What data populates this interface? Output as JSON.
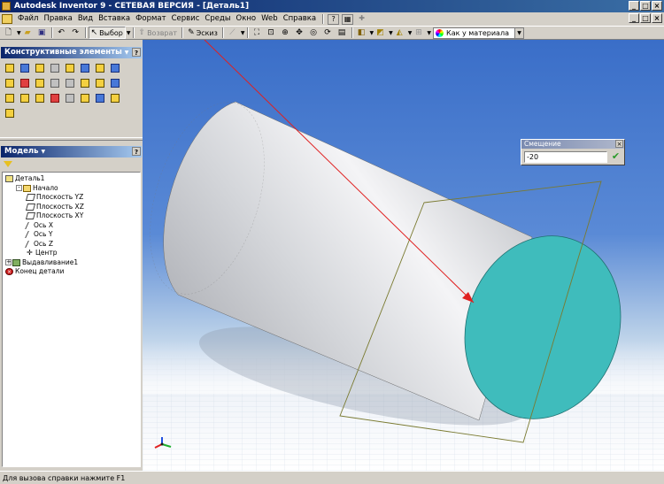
{
  "window": {
    "title": "Autodesk Inventor 9 - СЕТЕВАЯ ВЕРСИЯ - [Деталь1]",
    "controls": [
      "_",
      "□",
      "×"
    ]
  },
  "menu": {
    "items": [
      "Файл",
      "Правка",
      "Вид",
      "Вставка",
      "Формат",
      "Сервис",
      "Среды",
      "Окно",
      "Web",
      "Справка"
    ],
    "help_button": "?"
  },
  "toolbar": {
    "select_label": "Выбор",
    "return_label": "Возврат",
    "sketch_label": "Эскиз",
    "material_value": "Как у материала"
  },
  "features_panel": {
    "title": "Конструктивные элементы",
    "icons": [
      "extrude-icon",
      "revolve-icon",
      "hole-icon",
      "shell-icon",
      "rib-icon",
      "loft-icon",
      "sweep-icon",
      "coil-icon",
      "thread-icon",
      "fillet-icon",
      "chamfer-icon",
      "face-draft-icon",
      "split-icon",
      "move-face-icon",
      "mirror-icon",
      "pattern-icon",
      "work-plane-icon",
      "work-axis-icon",
      "work-point-icon",
      "ucs-icon",
      "derive-icon",
      "parameters-icon",
      "insert-ipart-icon",
      "create-ipart-icon",
      "bend-icon"
    ]
  },
  "model_panel": {
    "title": "Модель",
    "tree": [
      {
        "label": "Деталь1",
        "level": 0,
        "icon": "part-icon",
        "expander": ""
      },
      {
        "label": "Начало",
        "level": 1,
        "icon": "folder-icon",
        "expander": "-"
      },
      {
        "label": "Плоскость YZ",
        "level": 2,
        "icon": "plane-icon",
        "expander": ""
      },
      {
        "label": "Плоскость XZ",
        "level": 2,
        "icon": "plane-icon",
        "expander": ""
      },
      {
        "label": "Плоскость XY",
        "level": 2,
        "icon": "plane-icon",
        "expander": ""
      },
      {
        "label": "Ось X",
        "level": 2,
        "icon": "axis-icon",
        "expander": ""
      },
      {
        "label": "Ось Y",
        "level": 2,
        "icon": "axis-icon",
        "expander": ""
      },
      {
        "label": "Ось Z",
        "level": 2,
        "icon": "axis-icon",
        "expander": ""
      },
      {
        "label": "Центр",
        "level": 2,
        "icon": "point-icon",
        "expander": ""
      },
      {
        "label": "Выдавливание1",
        "level": 0,
        "icon": "extrusion-icon",
        "expander": "+"
      },
      {
        "label": "Конец детали",
        "level": 0,
        "icon": "end-of-part-icon",
        "expander": ""
      }
    ]
  },
  "offset_dialog": {
    "title": "Смещение",
    "value": "-20",
    "close": "×",
    "ok": "✔"
  },
  "colors": {
    "cylinder_face": "#3fbcbc",
    "arrow": "#e02020",
    "work_plane_outline": "#7a7a30",
    "viewport_top": "#3a6ec8"
  },
  "status": {
    "text": "Для вызова справки нажмите F1"
  }
}
